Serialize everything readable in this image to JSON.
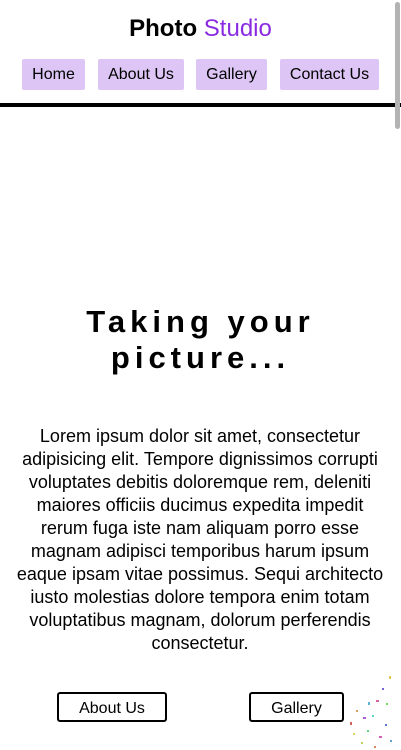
{
  "header": {
    "brand_bold": "Photo",
    "brand_accent": "Studio",
    "brand_accent_color": "#8a2be2"
  },
  "nav": {
    "items": [
      "Home",
      "About Us",
      "Gallery",
      "Contact Us"
    ],
    "item_background": "#ddc6f5"
  },
  "hero": {
    "title_line1": "Taking your",
    "title_line2": "picture...",
    "text": "Lorem ipsum dolor sit amet, consectetur adipisicing elit. Tempore dignissimos corrupti voluptates debitis doloremque rem, deleniti maiores officiis ducimus expedita impedit rerum fuga iste nam aliquam porro esse magnam adipisci temporibus harum ipsum eaque ipsam vitae possimus. Sequi architecto iusto molestias dolore tempora enim totam voluptatibus magnam, dolorum perferendis consectetur."
  },
  "cta": {
    "about_label": "About Us",
    "gallery_label": "Gallery"
  }
}
